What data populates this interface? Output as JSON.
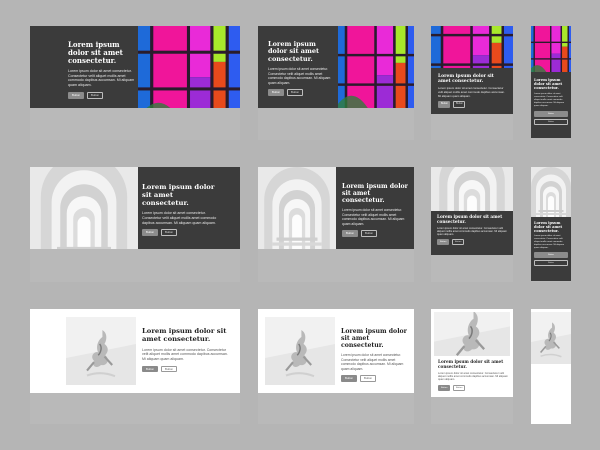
{
  "card": {
    "title": "Lorem ipsum dolor sit amet consectetur.",
    "body": "Lorem ipsum dolor sit amet consectetur. Consectetur velit aliquet mollis amet commodo dapibus accumsan. Mi aliquam quam aliquam.",
    "primary_label": "Button",
    "secondary_label": "Button"
  },
  "icons": {
    "row1": "stained-glass-image",
    "row2": "white-arches-image",
    "row3": "sculpture-image"
  },
  "colors": {
    "canvas": "#b5b5b5",
    "card_dark": "#3b3b3b",
    "card_light": "#ffffff",
    "button_primary": "#8c8c8c"
  }
}
